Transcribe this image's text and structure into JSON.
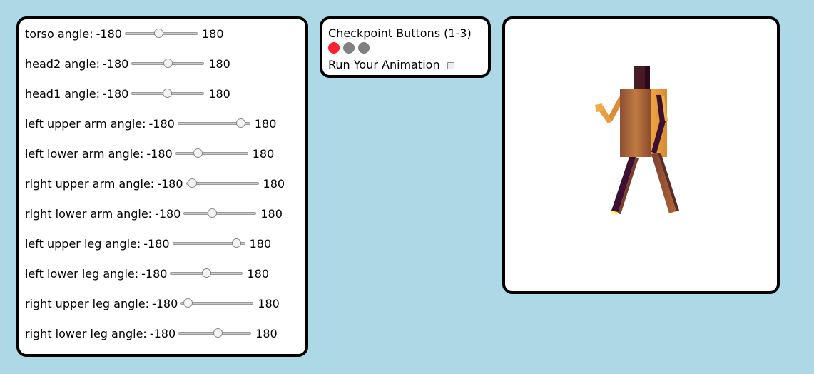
{
  "sliders": [
    {
      "label": "torso angle:",
      "min_label": "-180",
      "max_label": "180",
      "value": -15
    },
    {
      "label": "head2 angle:",
      "min_label": "-180",
      "max_label": "180",
      "value": 0
    },
    {
      "label": "head1 angle:",
      "min_label": "-180",
      "max_label": "180",
      "value": -5
    },
    {
      "label": "left upper arm angle:",
      "min_label": "-180",
      "max_label": "180",
      "value": 150
    },
    {
      "label": "left lower arm angle:",
      "min_label": "-180",
      "max_label": "180",
      "value": -80
    },
    {
      "label": "right upper arm angle:",
      "min_label": "-180",
      "max_label": "180",
      "value": -172
    },
    {
      "label": "right lower arm angle:",
      "min_label": "-180",
      "max_label": "180",
      "value": -45
    },
    {
      "label": "left upper leg angle:",
      "min_label": "-180",
      "max_label": "180",
      "value": 155
    },
    {
      "label": "left lower leg angle:",
      "min_label": "-180",
      "max_label": "180",
      "value": 0
    },
    {
      "label": "right upper leg angle:",
      "min_label": "-180",
      "max_label": "180",
      "value": -165
    },
    {
      "label": "right lower leg angle:",
      "min_label": "-180",
      "max_label": "180",
      "value": 15
    }
  ],
  "checkpoint": {
    "title": "Checkpoint Buttons (1-3)",
    "buttons": [
      {
        "active": true,
        "color": "#ff1f2d"
      },
      {
        "active": false,
        "color": "#808080"
      },
      {
        "active": false,
        "color": "#808080"
      }
    ],
    "run_label": "Run Your Animation",
    "run_checked": false
  },
  "colors": {
    "background": "#add8e6",
    "panel": "#ffffff",
    "border": "#000000",
    "figure_light": "#e8a347",
    "figure_mid": "#a6633a",
    "figure_dark": "#3b1030",
    "foot_highlight": "#fff176"
  }
}
